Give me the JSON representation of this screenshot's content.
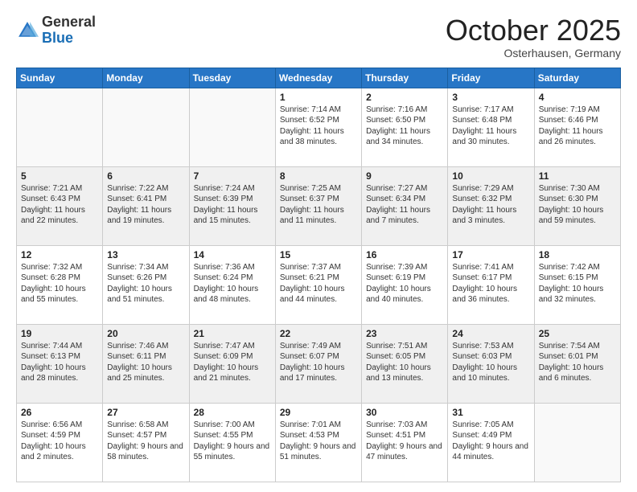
{
  "header": {
    "logo_general": "General",
    "logo_blue": "Blue",
    "month": "October 2025",
    "location": "Osterhausen, Germany"
  },
  "days_of_week": [
    "Sunday",
    "Monday",
    "Tuesday",
    "Wednesday",
    "Thursday",
    "Friday",
    "Saturday"
  ],
  "weeks": [
    [
      {
        "day": "",
        "info": ""
      },
      {
        "day": "",
        "info": ""
      },
      {
        "day": "",
        "info": ""
      },
      {
        "day": "1",
        "info": "Sunrise: 7:14 AM\nSunset: 6:52 PM\nDaylight: 11 hours and 38 minutes."
      },
      {
        "day": "2",
        "info": "Sunrise: 7:16 AM\nSunset: 6:50 PM\nDaylight: 11 hours and 34 minutes."
      },
      {
        "day": "3",
        "info": "Sunrise: 7:17 AM\nSunset: 6:48 PM\nDaylight: 11 hours and 30 minutes."
      },
      {
        "day": "4",
        "info": "Sunrise: 7:19 AM\nSunset: 6:46 PM\nDaylight: 11 hours and 26 minutes."
      }
    ],
    [
      {
        "day": "5",
        "info": "Sunrise: 7:21 AM\nSunset: 6:43 PM\nDaylight: 11 hours and 22 minutes."
      },
      {
        "day": "6",
        "info": "Sunrise: 7:22 AM\nSunset: 6:41 PM\nDaylight: 11 hours and 19 minutes."
      },
      {
        "day": "7",
        "info": "Sunrise: 7:24 AM\nSunset: 6:39 PM\nDaylight: 11 hours and 15 minutes."
      },
      {
        "day": "8",
        "info": "Sunrise: 7:25 AM\nSunset: 6:37 PM\nDaylight: 11 hours and 11 minutes."
      },
      {
        "day": "9",
        "info": "Sunrise: 7:27 AM\nSunset: 6:34 PM\nDaylight: 11 hours and 7 minutes."
      },
      {
        "day": "10",
        "info": "Sunrise: 7:29 AM\nSunset: 6:32 PM\nDaylight: 11 hours and 3 minutes."
      },
      {
        "day": "11",
        "info": "Sunrise: 7:30 AM\nSunset: 6:30 PM\nDaylight: 10 hours and 59 minutes."
      }
    ],
    [
      {
        "day": "12",
        "info": "Sunrise: 7:32 AM\nSunset: 6:28 PM\nDaylight: 10 hours and 55 minutes."
      },
      {
        "day": "13",
        "info": "Sunrise: 7:34 AM\nSunset: 6:26 PM\nDaylight: 10 hours and 51 minutes."
      },
      {
        "day": "14",
        "info": "Sunrise: 7:36 AM\nSunset: 6:24 PM\nDaylight: 10 hours and 48 minutes."
      },
      {
        "day": "15",
        "info": "Sunrise: 7:37 AM\nSunset: 6:21 PM\nDaylight: 10 hours and 44 minutes."
      },
      {
        "day": "16",
        "info": "Sunrise: 7:39 AM\nSunset: 6:19 PM\nDaylight: 10 hours and 40 minutes."
      },
      {
        "day": "17",
        "info": "Sunrise: 7:41 AM\nSunset: 6:17 PM\nDaylight: 10 hours and 36 minutes."
      },
      {
        "day": "18",
        "info": "Sunrise: 7:42 AM\nSunset: 6:15 PM\nDaylight: 10 hours and 32 minutes."
      }
    ],
    [
      {
        "day": "19",
        "info": "Sunrise: 7:44 AM\nSunset: 6:13 PM\nDaylight: 10 hours and 28 minutes."
      },
      {
        "day": "20",
        "info": "Sunrise: 7:46 AM\nSunset: 6:11 PM\nDaylight: 10 hours and 25 minutes."
      },
      {
        "day": "21",
        "info": "Sunrise: 7:47 AM\nSunset: 6:09 PM\nDaylight: 10 hours and 21 minutes."
      },
      {
        "day": "22",
        "info": "Sunrise: 7:49 AM\nSunset: 6:07 PM\nDaylight: 10 hours and 17 minutes."
      },
      {
        "day": "23",
        "info": "Sunrise: 7:51 AM\nSunset: 6:05 PM\nDaylight: 10 hours and 13 minutes."
      },
      {
        "day": "24",
        "info": "Sunrise: 7:53 AM\nSunset: 6:03 PM\nDaylight: 10 hours and 10 minutes."
      },
      {
        "day": "25",
        "info": "Sunrise: 7:54 AM\nSunset: 6:01 PM\nDaylight: 10 hours and 6 minutes."
      }
    ],
    [
      {
        "day": "26",
        "info": "Sunrise: 6:56 AM\nSunset: 4:59 PM\nDaylight: 10 hours and 2 minutes."
      },
      {
        "day": "27",
        "info": "Sunrise: 6:58 AM\nSunset: 4:57 PM\nDaylight: 9 hours and 58 minutes."
      },
      {
        "day": "28",
        "info": "Sunrise: 7:00 AM\nSunset: 4:55 PM\nDaylight: 9 hours and 55 minutes."
      },
      {
        "day": "29",
        "info": "Sunrise: 7:01 AM\nSunset: 4:53 PM\nDaylight: 9 hours and 51 minutes."
      },
      {
        "day": "30",
        "info": "Sunrise: 7:03 AM\nSunset: 4:51 PM\nDaylight: 9 hours and 47 minutes."
      },
      {
        "day": "31",
        "info": "Sunrise: 7:05 AM\nSunset: 4:49 PM\nDaylight: 9 hours and 44 minutes."
      },
      {
        "day": "",
        "info": ""
      }
    ]
  ]
}
